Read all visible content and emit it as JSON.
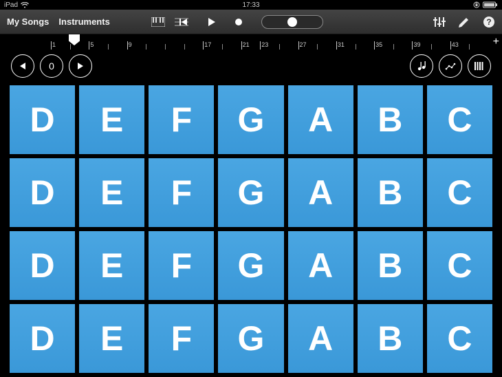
{
  "status": {
    "device": "iPad",
    "time": "17:33"
  },
  "toolbar": {
    "my_songs": "My Songs",
    "instruments": "Instruments"
  },
  "ruler": {
    "labels": [
      "1",
      "",
      "5",
      "",
      "9",
      "",
      "",
      "",
      "17",
      "",
      "21",
      "23",
      "",
      "27",
      "",
      "31",
      "",
      "35",
      "",
      "39",
      "",
      "43",
      ""
    ]
  },
  "octave": {
    "value": "0"
  },
  "notes": {
    "row0": [
      "D",
      "E",
      "F",
      "G",
      "A",
      "B",
      "C"
    ],
    "row1": [
      "D",
      "E",
      "F",
      "G",
      "A",
      "B",
      "C"
    ],
    "row2": [
      "D",
      "E",
      "F",
      "G",
      "A",
      "B",
      "C"
    ],
    "row3": [
      "D",
      "E",
      "F",
      "G",
      "A",
      "B",
      "C"
    ]
  }
}
